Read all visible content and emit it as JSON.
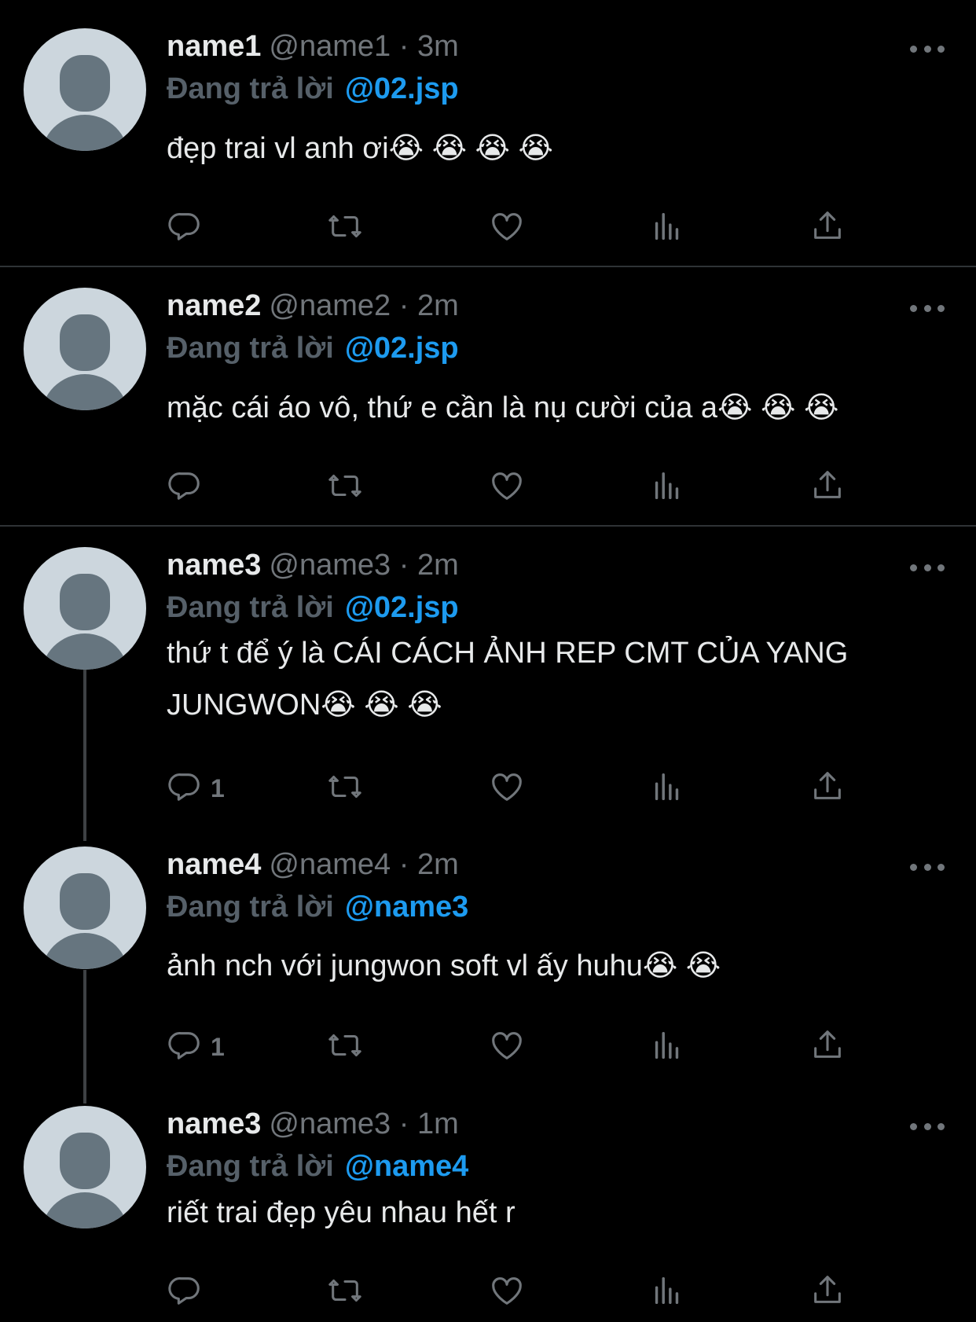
{
  "colors": {
    "background": "#000000",
    "text": "#e7e9ea",
    "muted": "#71767b",
    "accent": "#1d9bf0",
    "divider": "#2f3336"
  },
  "reply_prefix": "Đang trả lời",
  "emoji": "😭",
  "tweets": [
    {
      "name": "name1",
      "handle_time": "@name1 · 3m",
      "replying_to": "@02.jsp",
      "text": "đẹp trai vl anh ơi😭 😭 😭 😭",
      "reply_count": ""
    },
    {
      "name": "name2",
      "handle_time": "@name2 · 2m",
      "replying_to": "@02.jsp",
      "text": "mặc cái áo vô, thứ e cần là nụ cười của a😭 😭 😭",
      "reply_count": ""
    },
    {
      "name": "name3",
      "handle_time": "@name3 · 2m",
      "replying_to": "@02.jsp",
      "text": "thứ t để ý là CÁI CÁCH ẢNH REP CMT CỦA YANG JUNGWON😭 😭 😭",
      "reply_count": "1"
    },
    {
      "name": "name4",
      "handle_time": "@name4 · 2m",
      "replying_to": "@name3",
      "text": "ảnh nch với jungwon soft vl ấy huhu😭 😭",
      "reply_count": "1"
    },
    {
      "name": "name3",
      "handle_time": "@name3 · 1m",
      "replying_to": "@name4",
      "text": "riết trai đẹp yêu nhau hết r",
      "reply_count": ""
    }
  ],
  "icons": {
    "reply": "reply-icon",
    "retweet": "retweet-icon",
    "like": "like-icon",
    "views": "views-icon",
    "share": "share-icon",
    "more": "more-icon",
    "avatar": "default-avatar-icon"
  }
}
